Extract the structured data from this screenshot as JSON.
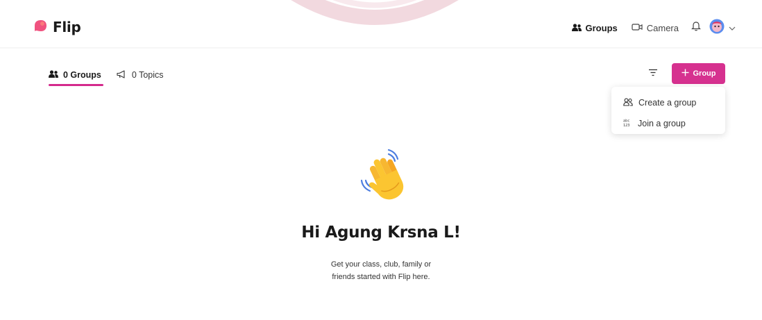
{
  "app": {
    "name": "Flip"
  },
  "header": {
    "groups_label": "Groups",
    "camera_label": "Camera"
  },
  "tabs": [
    {
      "label": "0 Groups",
      "active": true
    },
    {
      "label": "0 Topics",
      "active": false
    }
  ],
  "toolbar": {
    "new_group_label": "Group"
  },
  "menu": {
    "items": [
      {
        "label": "Create a group"
      },
      {
        "label": "Join a group"
      }
    ]
  },
  "welcome": {
    "greeting": "Hi Agung Krsna L!",
    "line1": "Get your class, club, family or",
    "line2": "friends started with Flip here."
  },
  "colors": {
    "accent": "#d6318f",
    "logo": "#f0527f"
  },
  "icons": [
    "flip-logo-icon",
    "groups-icon",
    "camera-icon",
    "bell-icon",
    "avatar-icon",
    "chevron-down-icon",
    "topics-icon",
    "filter-icon",
    "plus-icon",
    "create-group-icon",
    "join-group-icon",
    "waving-hand-icon"
  ]
}
